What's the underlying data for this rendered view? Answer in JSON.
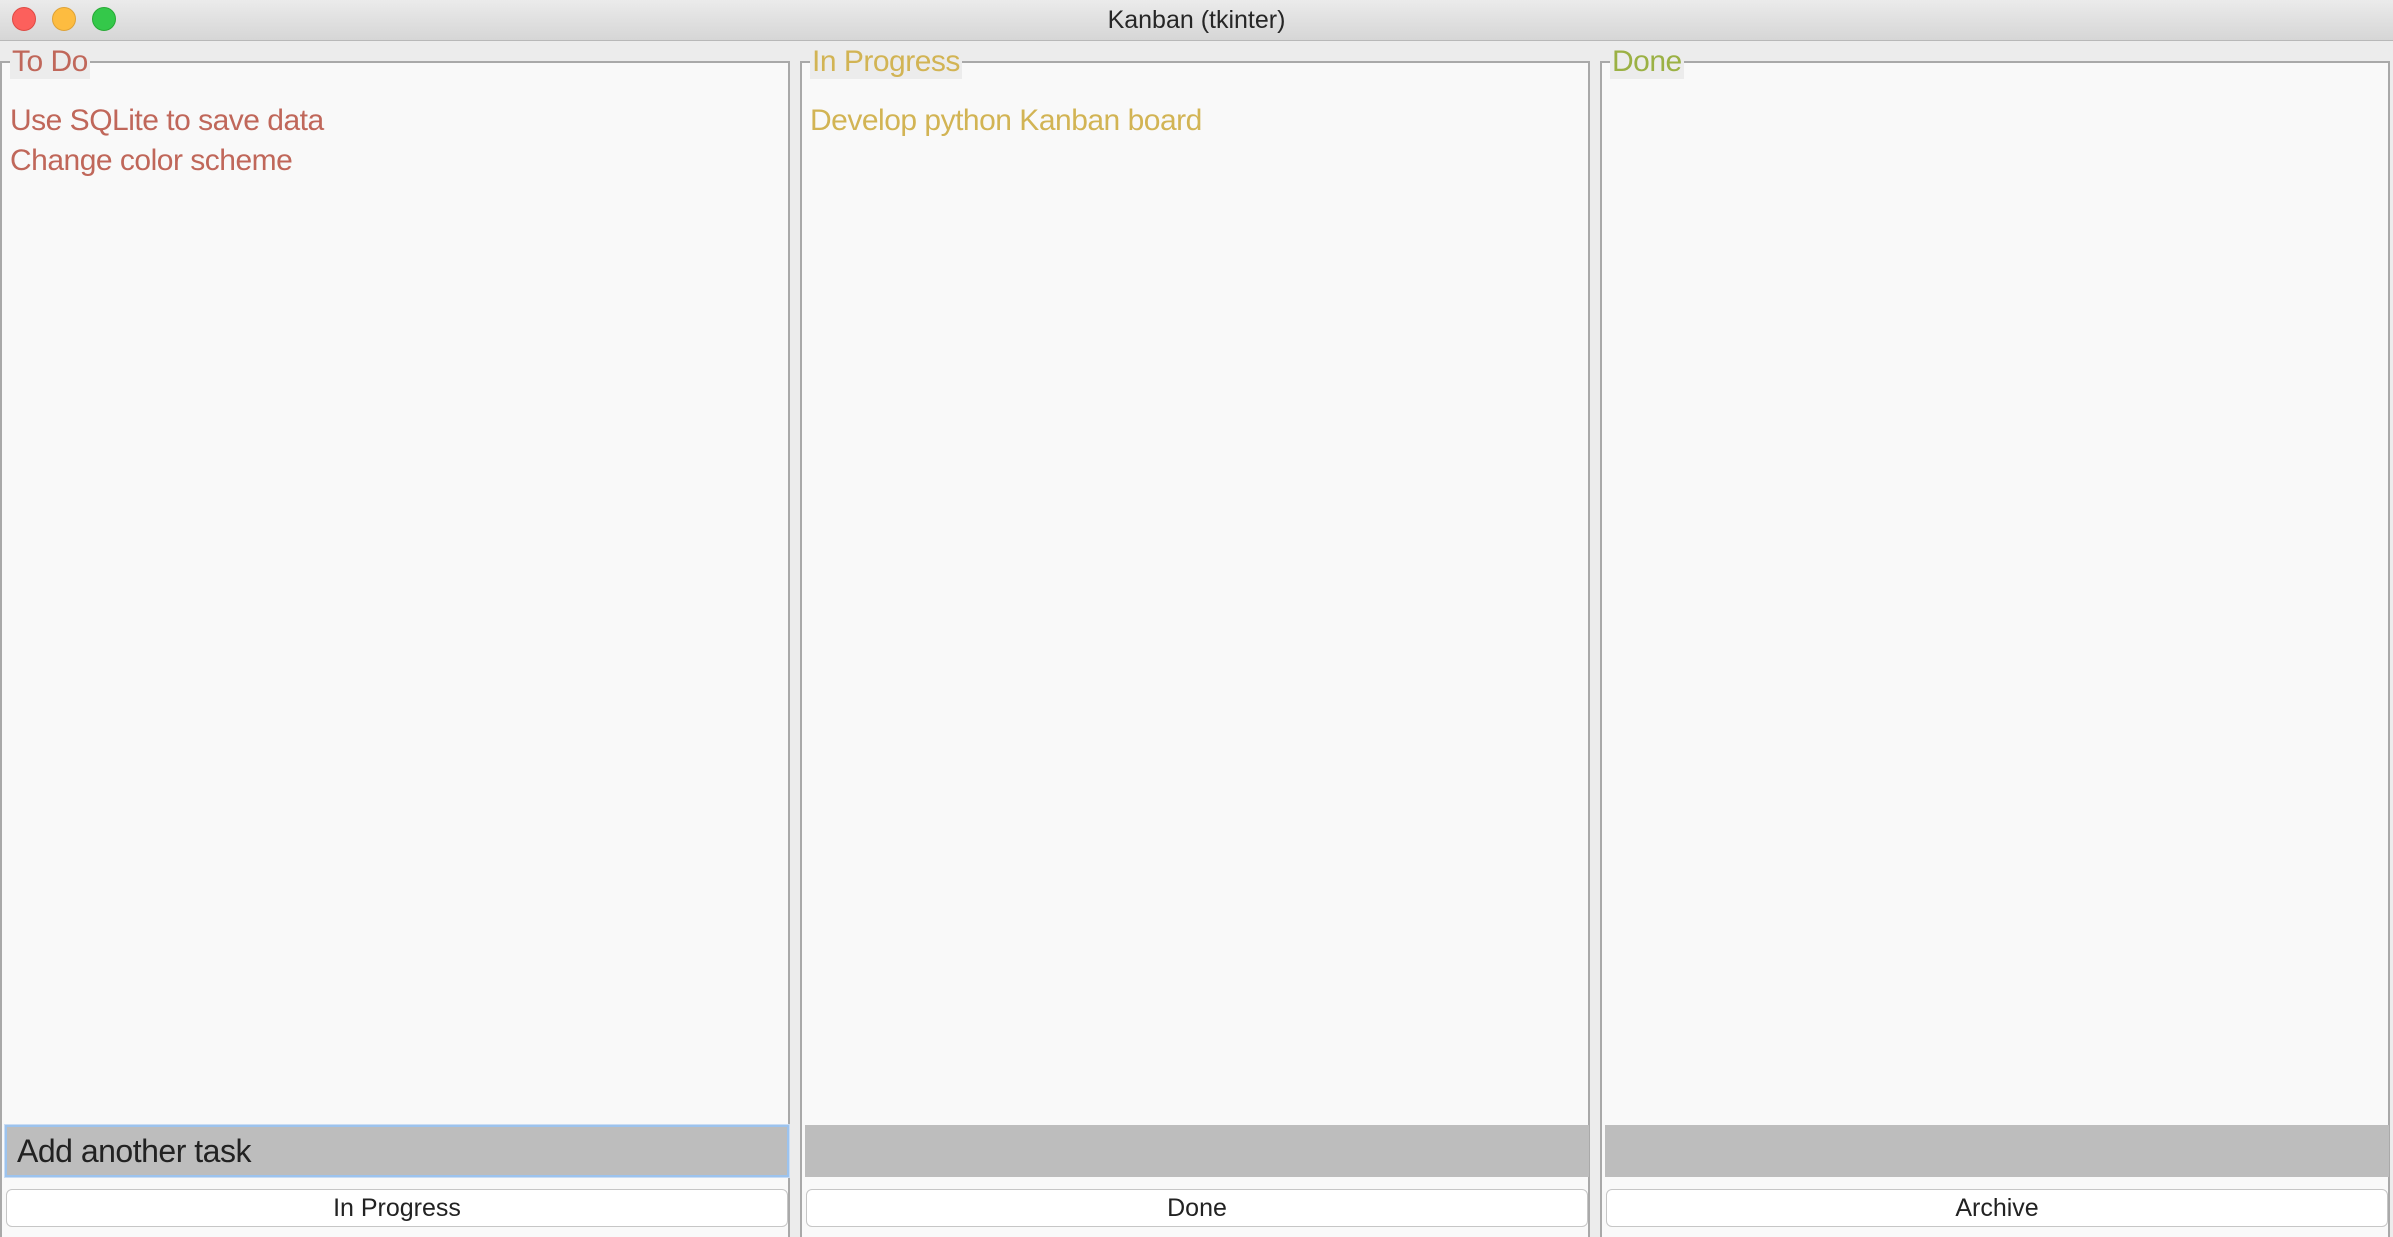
{
  "window": {
    "title": "Kanban (tkinter)"
  },
  "columns": [
    {
      "title": "To Do",
      "color": "#c0675a",
      "tasks": [
        "Use SQLite to save data",
        "Change color scheme"
      ],
      "input_value": "Add another task",
      "button_label": "In Progress"
    },
    {
      "title": "In Progress",
      "color": "#d2b454",
      "tasks": [
        "Develop python Kanban board"
      ],
      "input_value": "",
      "button_label": "Done"
    },
    {
      "title": "Done",
      "color": "#9bb144",
      "tasks": [],
      "input_value": "",
      "button_label": "Archive"
    }
  ]
}
